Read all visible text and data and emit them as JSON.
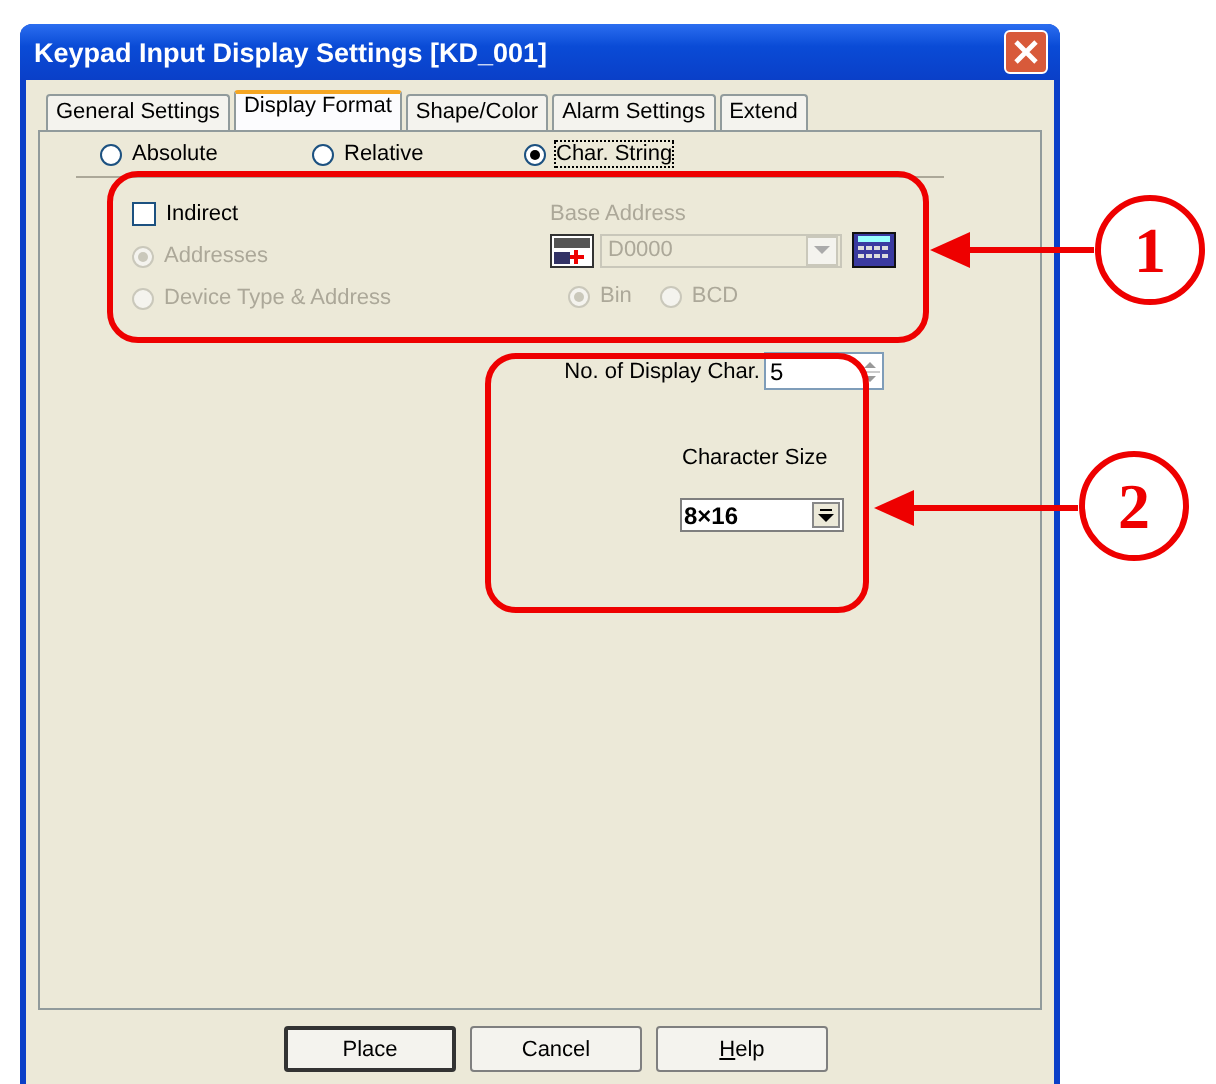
{
  "window": {
    "title": "Keypad Input Display Settings [KD_001]"
  },
  "tabs": [
    {
      "label": "General Settings",
      "selected": false
    },
    {
      "label": "Display Format",
      "selected": true
    },
    {
      "label": "Shape/Color",
      "selected": false
    },
    {
      "label": "Alarm Settings",
      "selected": false
    },
    {
      "label": "Extend",
      "selected": false
    }
  ],
  "mode_options": [
    {
      "label": "Absolute",
      "selected": false
    },
    {
      "label": "Relative",
      "selected": false
    },
    {
      "label": "Char. String",
      "selected": true
    }
  ],
  "indirect": {
    "label": "Indirect",
    "checked": false
  },
  "address_options": [
    {
      "label": "Addresses",
      "selected": true,
      "disabled": true
    },
    {
      "label": "Device Type & Address",
      "selected": false,
      "disabled": true
    }
  ],
  "base_address": {
    "label": "Base Address",
    "value": "D0000",
    "disabled": true
  },
  "format_options": [
    {
      "label": "Bin",
      "selected": true,
      "disabled": true
    },
    {
      "label": "BCD",
      "selected": false,
      "disabled": true
    }
  ],
  "display_chars": {
    "label": "No. of Display Char.",
    "value": "5"
  },
  "character_size": {
    "label": "Character Size",
    "value": "8×16"
  },
  "buttons": [
    {
      "label": "Place",
      "default": true
    },
    {
      "label": "Cancel",
      "default": false
    },
    {
      "label": "Help",
      "default": false
    }
  ],
  "callouts": [
    {
      "number": "1"
    },
    {
      "number": "2"
    }
  ]
}
